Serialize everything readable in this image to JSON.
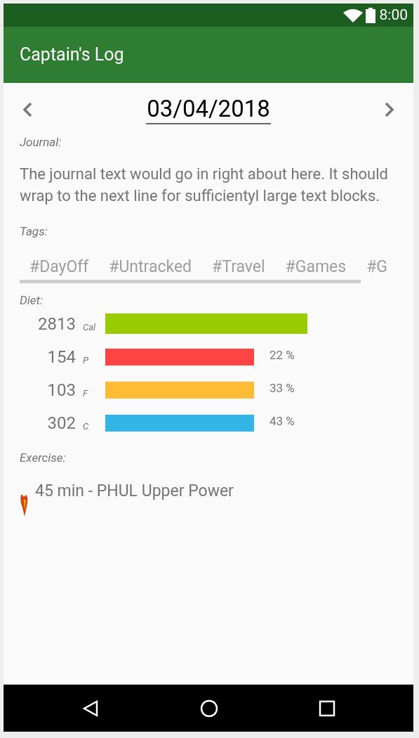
{
  "status_bar": {
    "time": "8:00"
  },
  "app_bar": {
    "title": "Captain's Log"
  },
  "date_nav": {
    "date": "03/04/2018"
  },
  "journal": {
    "label": "Journal:",
    "text": "The journal text would go in right about here. It should wrap to the next line for sufficientyl large text blocks."
  },
  "tags": {
    "label": "Tags:",
    "items": [
      "#DayOff",
      "#Untracked",
      "#Travel",
      "#Games",
      "#G"
    ]
  },
  "diet": {
    "label": "Diet:",
    "rows": [
      {
        "amount": "2813",
        "unit": "Cal",
        "color": "#99cc00"
      },
      {
        "amount": "154",
        "unit": "P",
        "color": "#ff4444",
        "percent": "22 %"
      },
      {
        "amount": "103",
        "unit": "F",
        "color": "#ffbb33",
        "percent": "33 %"
      },
      {
        "amount": "302",
        "unit": "C",
        "color": "#33b5e5",
        "percent": "43 %"
      }
    ]
  },
  "exercise": {
    "label": "Exercise:",
    "items": [
      "45 min - PHUL Upper Power"
    ]
  }
}
